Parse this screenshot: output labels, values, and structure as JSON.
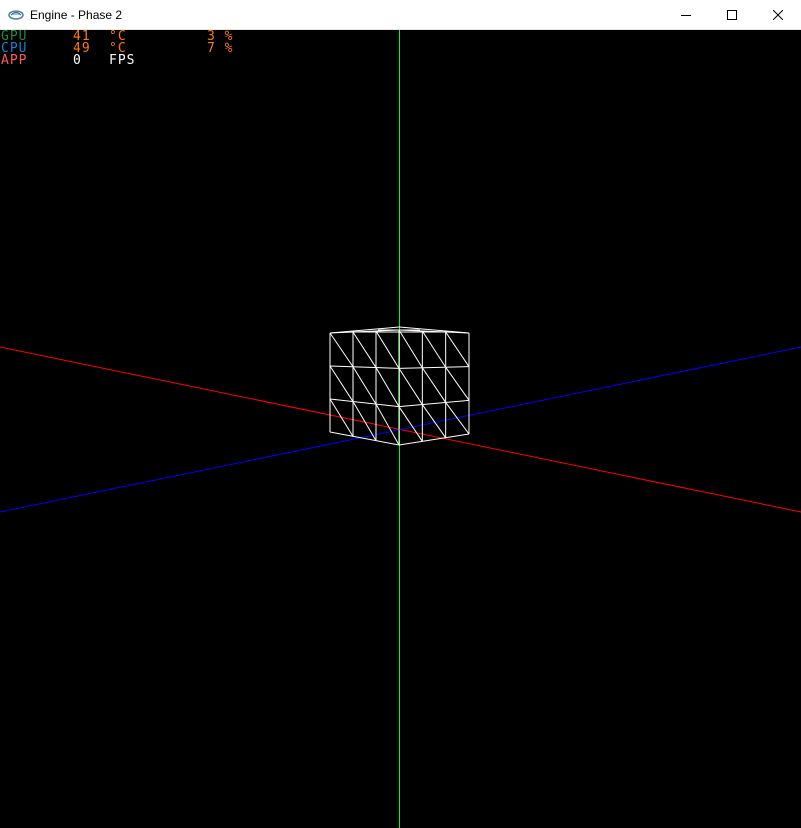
{
  "window": {
    "title": "Engine - Phase 2",
    "controls": {
      "minimize": "minimize-icon",
      "maximize": "maximize-icon",
      "close": "close-icon"
    }
  },
  "hud": {
    "rows": [
      {
        "label": "GPU",
        "value": "41",
        "unit": "°C",
        "load": "3 %",
        "label_color": "#1e8a3a",
        "value_color": "#ff7a00"
      },
      {
        "label": "CPU",
        "value": "49",
        "unit": "°C",
        "load": "7 %",
        "label_color": "#1a7fd6",
        "value_color": "#ff7a00"
      },
      {
        "label": "APP",
        "value": "0",
        "unit": "FPS",
        "load": "",
        "label_color": "#ff5a5a",
        "value_color": "#ffffff"
      }
    ]
  },
  "scene": {
    "axis_colors": {
      "x": "#ff0000",
      "y": "#00ff00",
      "z": "#0000ff"
    },
    "mesh_color": "#ffffff",
    "mesh": "wireframe cube, 3x3 subdivided faces"
  }
}
